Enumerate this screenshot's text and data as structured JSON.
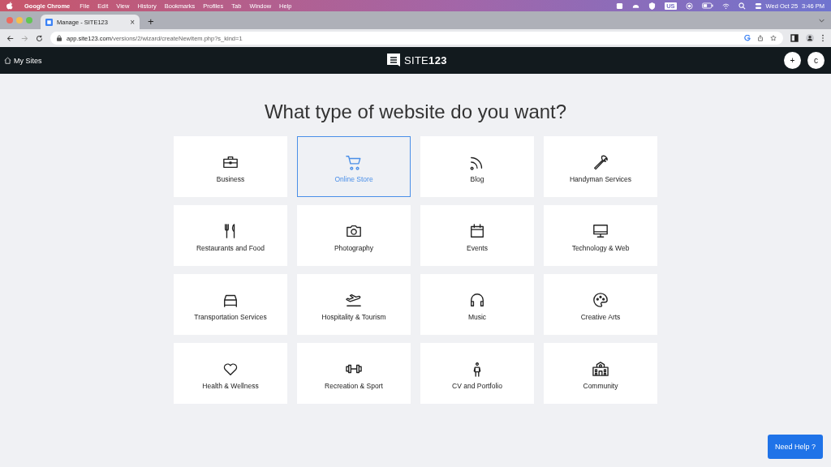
{
  "menu_bar": {
    "app": "Google Chrome",
    "items": [
      "File",
      "Edit",
      "View",
      "History",
      "Bookmarks",
      "Profiles",
      "Tab",
      "Window",
      "Help"
    ],
    "keyboard": "US",
    "date": "Wed Oct 25",
    "time": "3:46 PM"
  },
  "browser": {
    "tab": {
      "title": "Manage - SITE123",
      "close": "×"
    },
    "new_tab": "+",
    "url": {
      "host": "app.site123.com",
      "path": "/versions/2/wizard/createNewItem.php?s_kind=1"
    }
  },
  "header": {
    "my_sites": "My Sites",
    "logo": "SITE**123**",
    "add": "+",
    "user": "c"
  },
  "title": "What type of website do you want?",
  "types": [
    {
      "label": "Business",
      "selected": false
    },
    {
      "label": "Online Store",
      "selected": true
    },
    {
      "label": "Blog",
      "selected": false
    },
    {
      "label": "Handyman Services",
      "selected": false
    },
    {
      "label": "Restaurants and Food",
      "selected": false
    },
    {
      "label": "Photography",
      "selected": false
    },
    {
      "label": "Events",
      "selected": false
    },
    {
      "label": "Technology & Web",
      "selected": false
    },
    {
      "label": "Transportation Services",
      "selected": false
    },
    {
      "label": "Hospitality & Tourism",
      "selected": false
    },
    {
      "label": "Music",
      "selected": false
    },
    {
      "label": "Creative Arts",
      "selected": false
    },
    {
      "label": "Health & Wellness",
      "selected": false
    },
    {
      "label": "Recreation & Sport",
      "selected": false
    },
    {
      "label": "CV and Portfolio",
      "selected": false
    },
    {
      "label": "Community",
      "selected": false
    }
  ],
  "help": "Need Help ?"
}
